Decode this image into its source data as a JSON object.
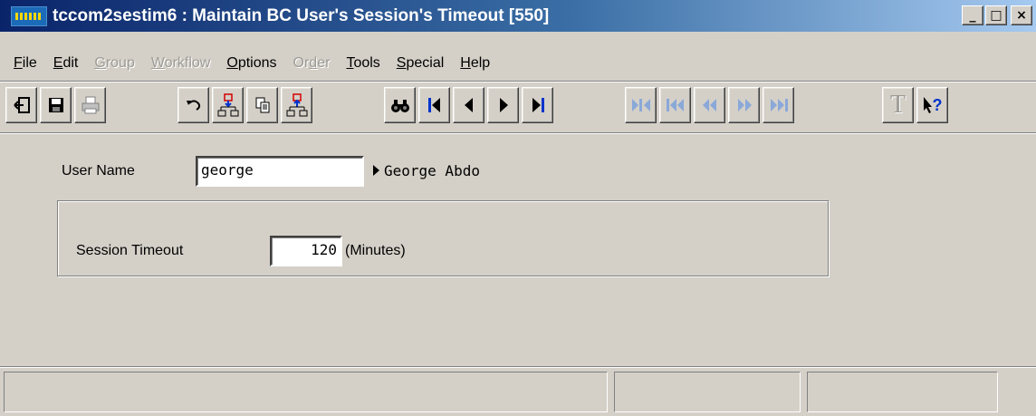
{
  "window": {
    "title": "tccom2sestim6 : Maintain BC User's Session's Timeout [550]",
    "minimize_glyph": "_",
    "maximize_glyph": "□",
    "close_glyph": "×"
  },
  "menu": [
    {
      "key": "F",
      "rest": "ile",
      "enabled": true
    },
    {
      "key": "E",
      "rest": "dit",
      "enabled": true
    },
    {
      "key": "G",
      "rest": "roup",
      "enabled": false
    },
    {
      "key": "W",
      "rest": "orkflow",
      "enabled": false
    },
    {
      "key": "O",
      "rest": "ptions",
      "enabled": true
    },
    {
      "prefix": "Or",
      "key": "d",
      "rest": "er",
      "enabled": false
    },
    {
      "key": "T",
      "rest": "ools",
      "enabled": true
    },
    {
      "key": "S",
      "rest": "pecial",
      "enabled": true
    },
    {
      "key": "H",
      "rest": "elp",
      "enabled": true
    }
  ],
  "toolbar": {
    "icons": [
      "exit-icon",
      "save-icon",
      "print-icon",
      "undo-icon",
      "insert-icon",
      "copy-icon",
      "duplicate-icon",
      "find-icon",
      "first-record-icon",
      "previous-record-icon",
      "next-record-icon",
      "last-record-icon",
      "first-set-icon",
      "previous-set-icon",
      "previous-group-icon",
      "next-group-icon",
      "last-set-icon",
      "text-icon",
      "context-help-icon"
    ],
    "text_glyph": "T",
    "help_glyph": "?"
  },
  "form": {
    "user_name_label": "User Name",
    "user_name_value": "george",
    "user_full_name": "George Abdo",
    "session_timeout_label": "Session Timeout",
    "session_timeout_value": "120",
    "session_timeout_unit": "(Minutes)"
  },
  "colors": {
    "title_start": "#0a246a",
    "title_end": "#a6caf0",
    "face": "#d4d0c8",
    "icon_red": "#d40000",
    "icon_blue": "#0033cc"
  }
}
